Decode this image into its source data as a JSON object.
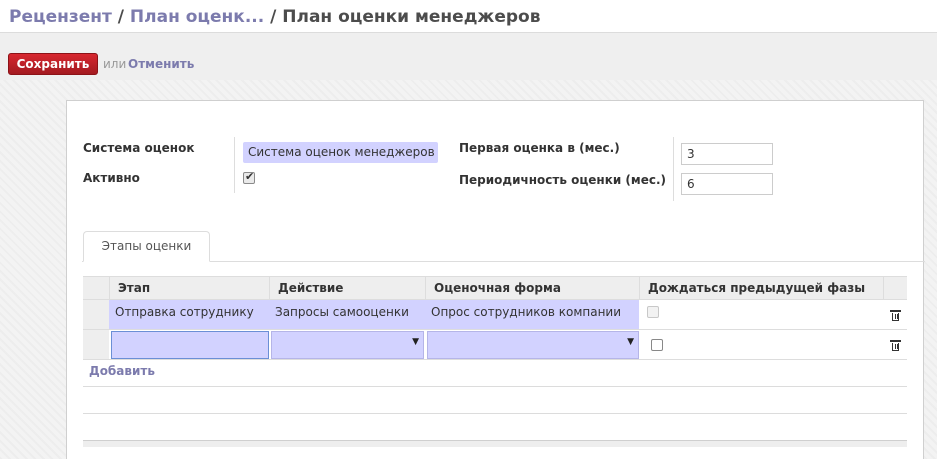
{
  "breadcrumb": {
    "link1": "Рецензент",
    "sep1": " / ",
    "link2": "План оценк...",
    "sep2": " / ",
    "current": "План оценки менеджеров"
  },
  "toolbar": {
    "save_label": "Сохранить",
    "or_label": "или",
    "cancel_label": "Отменить"
  },
  "form": {
    "evaluation_system_label": "Система оценок",
    "evaluation_system_value": "Система оценок менеджеров",
    "active_label": "Активно",
    "active_checked": true,
    "first_eval_label": "Первая оценка в (мес.)",
    "first_eval_value": "3",
    "periodicity_label": "Периодичность оценки (мес.)",
    "periodicity_value": "6"
  },
  "tabs": [
    {
      "label": "Этапы оценки"
    }
  ],
  "grid": {
    "columns": [
      "Этап",
      "Действие",
      "Оценочная форма",
      "Дождаться предыдущей фазы"
    ],
    "rows": [
      {
        "stage": "Отправка сотруднику",
        "action": "Запросы самооценки",
        "form": "Опрос сотрудников компании",
        "wait": false
      }
    ],
    "add_label": "Добавить"
  },
  "colors": {
    "accent": "#7c7bad",
    "save_button": "#c0222a",
    "readonly_field": "#d2d2ff"
  }
}
